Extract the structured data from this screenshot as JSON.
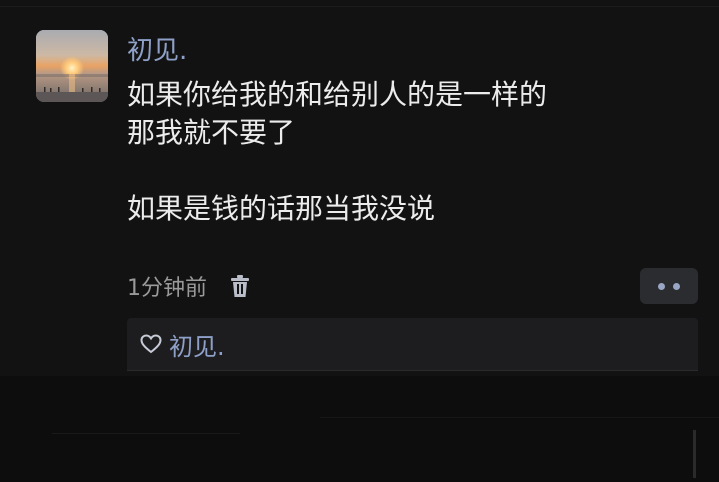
{
  "post": {
    "username": "初见.",
    "content_lines": [
      "如果你给我的和给别人的是一样的",
      "那我就不要了",
      "",
      "如果是钱的话那当我没说"
    ],
    "time": "1分钟前",
    "icons": {
      "delete": "trash-icon",
      "more": "more-dots-icon",
      "like": "heart-icon"
    }
  },
  "likes": {
    "names": [
      "初见."
    ]
  },
  "colors": {
    "background": "#121212",
    "username": "#8ea0c8",
    "text": "#ececec",
    "meta": "#9a9a9a",
    "likes_bg": "#1d1d1f"
  }
}
